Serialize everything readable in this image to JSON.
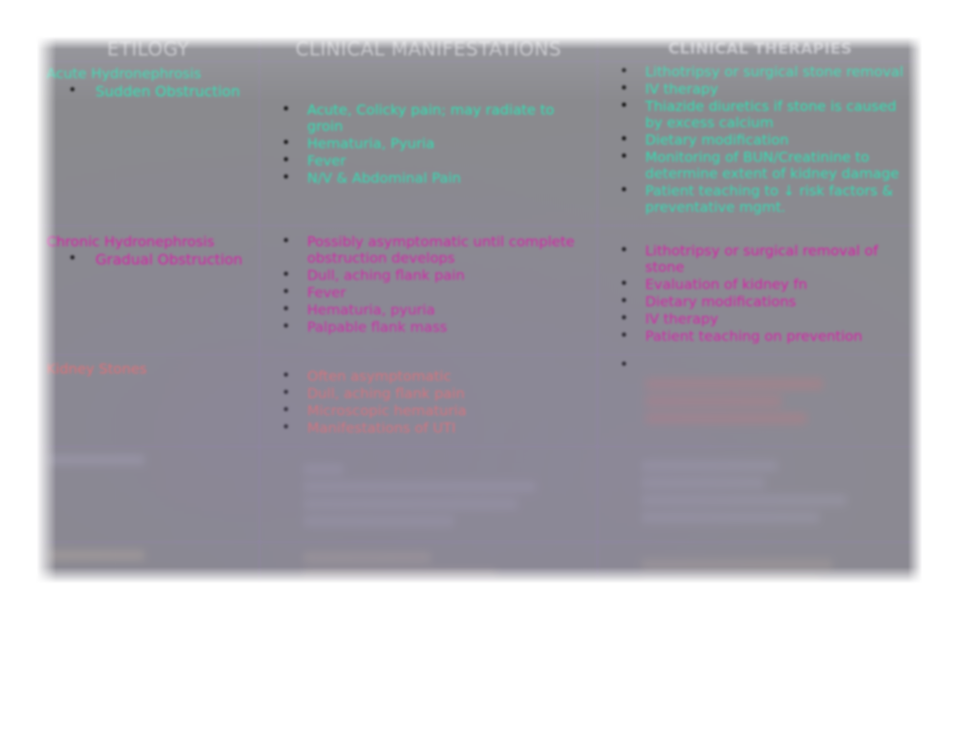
{
  "document": {
    "type": "slide-table",
    "colors": {
      "background": "#ffffff",
      "table_fill": "#8a8a8c",
      "grid_line": "#9684b6",
      "header_text": "#cfcfd2",
      "row_acute": "#2ee3b4",
      "row_chronic": "#e213a8",
      "row_stones": "#f2706e",
      "row_blurred_1": "#b9b7cf",
      "row_blurred_2": "#cfc1a6",
      "bullet": "#111111"
    }
  },
  "table": {
    "columns": [
      {
        "id": "etiology",
        "label": "ETILOGY"
      },
      {
        "id": "manifestations",
        "label": "CLINICAL MANIFESTATIONS"
      },
      {
        "id": "therapies",
        "label": "CLINICAL THERAPIES"
      }
    ],
    "rows": [
      {
        "id": "acute-hydronephrosis",
        "color": "#2ee3b4",
        "etiology": {
          "title": "Acute Hydronephrosis",
          "bullets": [
            "Sudden Obstruction"
          ]
        },
        "manifestations": [
          "Acute, Colicky pain; may radiate to groin",
          "Hematuria, Pyuria",
          "Fever",
          "N/V & Abdominal Pain"
        ],
        "therapies": [
          "Lithotripsy or surgical stone removal",
          "IV therapy",
          "Thiazide diuretics if stone is caused by excess calcium",
          "Dietary modification",
          "Monitoring of BUN/Creatinine to determine extent of kidney damage",
          "Patient teaching to ↓ risk factors & preventative mgmt."
        ]
      },
      {
        "id": "chronic-hydronephrosis",
        "color": "#e213a8",
        "etiology": {
          "title": "Chronic Hydronephrosis",
          "bullets": [
            "Gradual Obstruction"
          ]
        },
        "manifestations": [
          "Possibly asymptomatic until complete obstruction develops",
          "Dull, aching flank pain",
          "Fever",
          "Hematuria, pyuria",
          "Palpable flank mass"
        ],
        "therapies": [
          "Lithotripsy or surgical removal of stone",
          "Evaluation of kidney fn",
          "Dietary modifications",
          "IV therapy",
          "Patient teaching on prevention"
        ]
      },
      {
        "id": "kidney-stones",
        "color": "#f2706e",
        "etiology": {
          "title": "Kidney Stones",
          "bullets": []
        },
        "manifestations": [
          "Often asymptomatic",
          "Dull, aching flank pain",
          "Microscopic hematuria",
          "Manifestations of UTI"
        ],
        "therapies": []
      },
      {
        "id": "blurred-row-1",
        "color": "#b9b7cf",
        "illegible": true,
        "etiology": {
          "title": "",
          "bullets": []
        },
        "manifestations": [],
        "therapies": []
      },
      {
        "id": "blurred-row-2",
        "color": "#cfc1a6",
        "illegible": true,
        "etiology": {
          "title": "",
          "bullets": []
        },
        "manifestations": [],
        "therapies": []
      }
    ]
  }
}
